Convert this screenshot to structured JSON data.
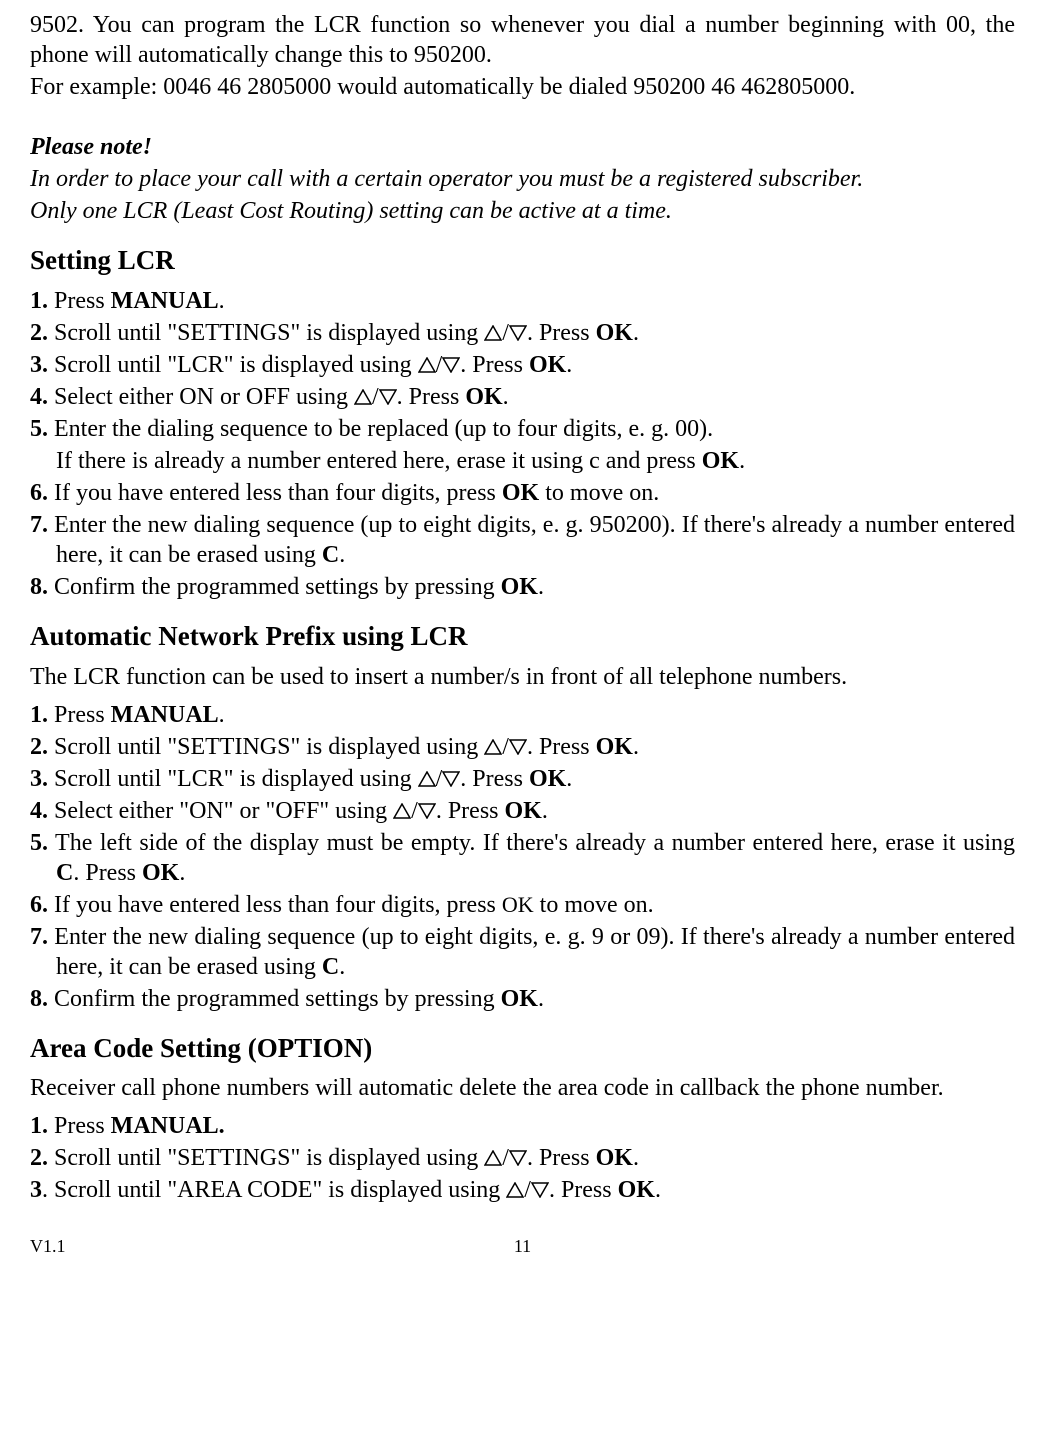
{
  "intro": {
    "p1": "9502. You can program the LCR function so whenever you dial a number beginning with 00, the phone will automatically change this to 950200.",
    "p2": "For example: 0046 46 2805000 would automatically be dialed 950200 46 462805000."
  },
  "note": {
    "title": "Please note!",
    "line1": "In order to place your call with a certain operator you must be a registered subscriber.",
    "line2": "Only one LCR (Least Cost Routing) setting can be active at a time."
  },
  "sectionA": {
    "heading": "Setting LCR",
    "steps": {
      "s1_num": "1.",
      "s1_a": " Press ",
      "s1_b": "MANUAL",
      "s1_c": ".",
      "s2_num": "2.",
      "s2_a": " Scroll until \"SETTINGS\" is displayed using ",
      "s2_b": ". Press ",
      "s2_c": "OK",
      "s2_d": ".",
      "s3_num": "3.",
      "s3_a": " Scroll until \"LCR\" is displayed using ",
      "s3_b": ". Press ",
      "s3_c": "OK",
      "s3_d": ".",
      "s4_num": "4.",
      "s4_a": " Select either ON or OFF using ",
      "s4_b": ". Press ",
      "s4_c": "OK",
      "s4_d": ".",
      "s5_num": "5.",
      "s5_a": " Enter the dialing sequence to be replaced (up to four digits, e. g. 00).",
      "s5_cont_a": "If there is already a number entered here, erase it using c and press ",
      "s5_cont_b": "OK",
      "s5_cont_c": ".",
      "s6_num": "6.",
      "s6_a": " If you have entered less than four digits, press ",
      "s6_b": "OK",
      "s6_c": " to move on.",
      "s7_num": "7.",
      "s7_a": " Enter the new dialing sequence (up to eight digits, e. g. 950200). If there's already a number entered here, it can be erased using ",
      "s7_b": "C",
      "s7_c": ".",
      "s8_num": "8.",
      "s8_a": " Confirm the programmed settings by pressing ",
      "s8_b": "OK",
      "s8_c": "."
    }
  },
  "sectionB": {
    "heading": "Automatic Network Prefix using LCR",
    "desc": "The LCR function can be used to insert a number/s in front of all telephone numbers.",
    "steps": {
      "s1_num": "1.",
      "s1_a": " Press ",
      "s1_b": "MANUAL",
      "s1_c": ".",
      "s2_num": "2.",
      "s2_a": " Scroll until \"SETTINGS\" is displayed using ",
      "s2_b": ". Press ",
      "s2_c": "OK",
      "s2_d": ".",
      "s3_num": "3.",
      "s3_a": " Scroll until \"LCR\" is displayed using ",
      "s3_b": ". Press ",
      "s3_c": "OK",
      "s3_d": ".",
      "s4_num": "4.",
      "s4_a": " Select either \"ON\" or \"OFF\" using ",
      "s4_b": ". Press ",
      "s4_c": "OK",
      "s4_d": ".",
      "s5_num": "5.",
      "s5_a": " The left side of the display must be empty. If there's already a number entered here, erase it using ",
      "s5_b": "C",
      "s5_c": ". Press ",
      "s5_d": "OK",
      "s5_e": ".",
      "s6_num": "6.",
      "s6_a": " If you have entered less than four digits, press ",
      "s6_b": "OK",
      "s6_c": " to move on.",
      "s7_num": "7.",
      "s7_a": " Enter the new dialing sequence (up to eight digits, e. g. 9 or 09). If   there's already a number entered here, it can be erased using ",
      "s7_b": "C",
      "s7_c": ".",
      "s8_num": "8.",
      "s8_a": " Confirm the programmed settings by pressing ",
      "s8_b": "OK",
      "s8_c": "."
    }
  },
  "sectionC": {
    "heading": "Area Code Setting (OPTION)",
    "desc": "Receiver call phone numbers will automatic delete the area code in callback the phone number.",
    "steps": {
      "s1_num": "1.",
      "s1_a": " Press ",
      "s1_b": "MANUAL.",
      "s2_num": "2.",
      "s2_a": " Scroll until \"SETTINGS\" is displayed using ",
      "s2_b": ". Press ",
      "s2_c": "OK",
      "s2_d": ".",
      "s3_num": "3",
      "s3_a": ". Scroll until \"AREA CODE\" is displayed using ",
      "s3_b": ". Press ",
      "s3_c": "OK",
      "s3_d": "."
    }
  },
  "footer": {
    "version": "V1.1",
    "page": "11"
  }
}
